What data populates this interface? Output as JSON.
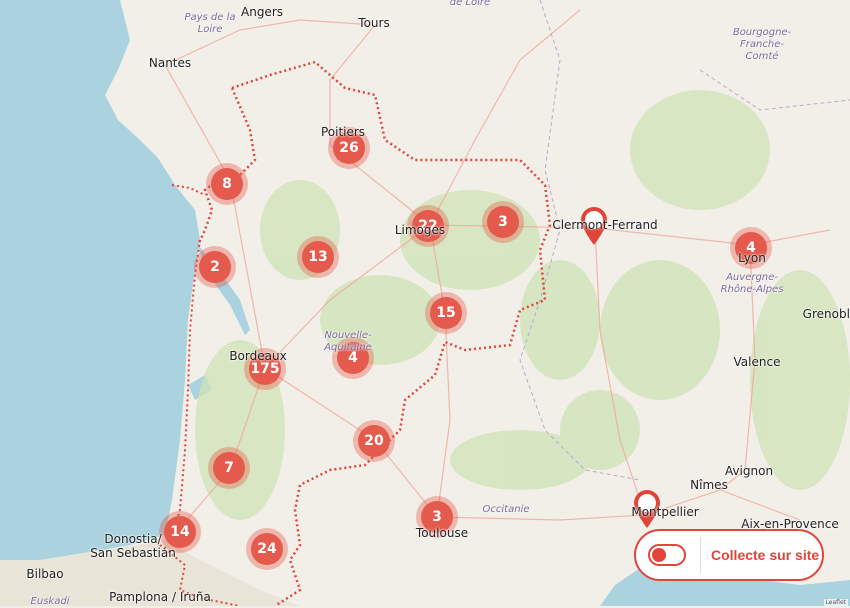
{
  "map": {
    "labels": [
      {
        "text": "Angers",
        "class": "big"
      },
      {
        "text": "Tours",
        "class": "big"
      },
      {
        "text": "Nantes",
        "class": "big"
      },
      {
        "text": "Poitiers",
        "class": "big"
      },
      {
        "text": "Limoges",
        "class": "big"
      },
      {
        "text": "Bordeaux",
        "class": "big"
      },
      {
        "text": "Toulouse",
        "class": "big"
      },
      {
        "text": "Lyon",
        "class": "big"
      },
      {
        "text": "Clermont-Ferrand",
        "class": "big"
      },
      {
        "text": "Grenoble",
        "class": "big"
      },
      {
        "text": "Valence",
        "class": "big"
      },
      {
        "text": "Avignon",
        "class": "big"
      },
      {
        "text": "Nîmes",
        "class": "big"
      },
      {
        "text": "Montpellier",
        "class": "big"
      },
      {
        "text": "Aix-en-Provence",
        "class": "big"
      },
      {
        "text": "Bilbao",
        "class": "big"
      },
      {
        "text": "Pamplona / Iruña",
        "class": "big"
      },
      {
        "text": "Donostia/ San Sebastián",
        "class": "big"
      },
      {
        "text": "Pays de la Loire",
        "class": "region"
      },
      {
        "text": "Bourgogne-Franche-Comté",
        "class": "region"
      },
      {
        "text": "Auvergne-Rhône-Alpes",
        "class": "region"
      },
      {
        "text": "Nouvelle-Aquitaine",
        "class": "region"
      },
      {
        "text": "Occitanie",
        "class": "region"
      },
      {
        "text": "Euskadi",
        "class": "region"
      },
      {
        "text": "de Loire",
        "class": "region"
      }
    ],
    "clusters": [
      {
        "count": "26"
      },
      {
        "count": "8"
      },
      {
        "count": "22"
      },
      {
        "count": "3"
      },
      {
        "count": "13"
      },
      {
        "count": "2"
      },
      {
        "count": "15"
      },
      {
        "count": "4"
      },
      {
        "count": "175"
      },
      {
        "count": "20"
      },
      {
        "count": "7"
      },
      {
        "count": "14"
      },
      {
        "count": "24"
      },
      {
        "count": "3"
      },
      {
        "count": "4"
      }
    ],
    "pins": [
      {
        "name": "clermont-ferrand-pin"
      },
      {
        "name": "montpellier-pin"
      }
    ],
    "attribution": "Leaflet"
  },
  "control": {
    "label": "Collecte sur site",
    "toggle_on": false,
    "accent": "#e0453a"
  }
}
